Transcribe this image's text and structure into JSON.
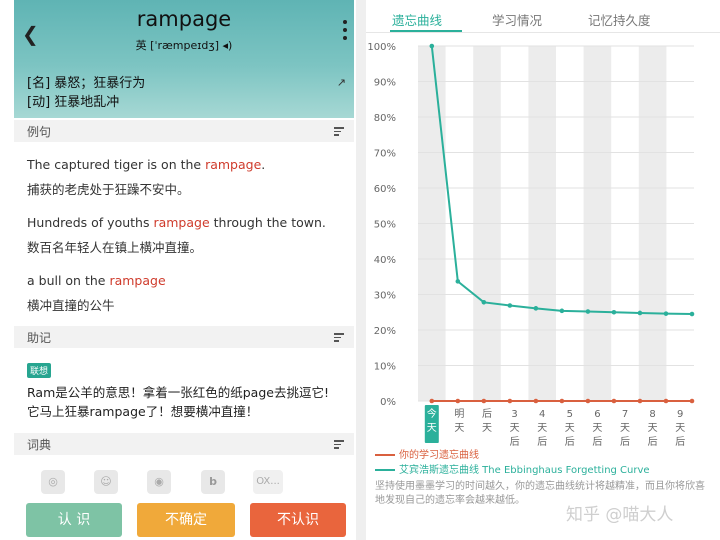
{
  "word": {
    "title": "rampage",
    "phonetic": "英 [ˈræmpeɪdʒ] ◂)",
    "defs": [
      "[名] 暴怒；狂暴行为",
      "[动] 狂暴地乱冲"
    ]
  },
  "sections": {
    "examples": "例句",
    "notes": "助记",
    "dicts": "词典"
  },
  "examples": [
    {
      "en_pre": "The captured tiger is on the ",
      "hl": "rampage",
      "en_post": ".",
      "zh": "捕获的老虎处于狂躁不安中。"
    },
    {
      "en_pre": "Hundreds of youths ",
      "hl": "rampage",
      "en_post": " through the town.",
      "zh": "数百名年轻人在镇上横冲直撞。"
    },
    {
      "en_pre": "a bull on the ",
      "hl": "rampage",
      "en_post": "",
      "zh": "横冲直撞的公牛"
    }
  ],
  "note": {
    "tag": "联想",
    "line1": "Ram是公羊的意思！拿着一张红色的纸page去挑逗它!",
    "line2": "它马上狂暴rampage了！想要横冲直撞！"
  },
  "dict_icons": [
    "dict-icon-1",
    "dict-icon-2",
    "dict-icon-3",
    "bing-icon",
    "oxford-icon"
  ],
  "dict_oxford_text": "OX...",
  "buttons": {
    "know": "认 识",
    "unsure": "不确定",
    "unknown": "不认识"
  },
  "colors": {
    "know": "#7ec3a5",
    "unsure": "#f0a93a",
    "unknown": "#e9653d",
    "accent": "#2bb09b",
    "red": "#d9603f"
  },
  "tabs": [
    "遗忘曲线",
    "学习情况",
    "记忆持久度"
  ],
  "chart_data": {
    "type": "line",
    "y_ticks": [
      "100%",
      "90%",
      "80%",
      "70%",
      "60%",
      "50%",
      "40%",
      "30%",
      "20%",
      "10%",
      "0%"
    ],
    "ylim": [
      0,
      100
    ],
    "categories": [
      "今天",
      "明天",
      "后天",
      "3天后",
      "4天后",
      "5天后",
      "6天后",
      "7天后",
      "8天后",
      "9天后"
    ],
    "series": [
      {
        "name": "你的学习遗忘曲线",
        "color": "#d9603f",
        "values": [
          0,
          0,
          0,
          0,
          0,
          0,
          0,
          0,
          0,
          0,
          0
        ]
      },
      {
        "name": "艾宾浩斯遗忘曲线 The Ebbinghaus Forgetting Curve",
        "color": "#2bb09b",
        "values": [
          100,
          33.7,
          27.8,
          26.9,
          26.1,
          25.4,
          25.2,
          25.0,
          24.8,
          24.6,
          24.5
        ]
      }
    ],
    "grid": "alternating vertical bands"
  },
  "footer": "坚持使用墨墨学习的时间越久，你的遗忘曲线统计将越精准，而且你将欣喜地发现自己的遗忘率会越来越低。",
  "watermark": "知乎 @喵大人"
}
